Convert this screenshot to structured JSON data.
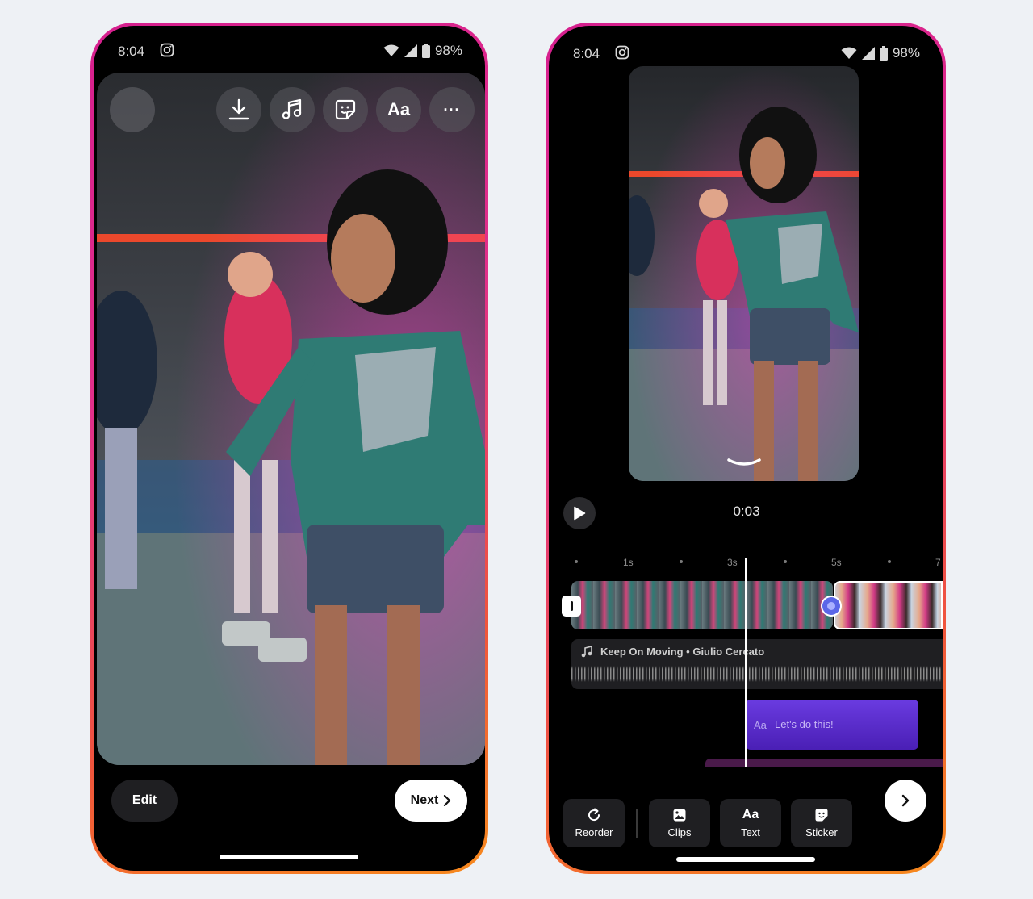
{
  "left_phone": {
    "status": {
      "time": "8:04",
      "battery": "98%"
    },
    "toolbar": {
      "icons": [
        "download-icon",
        "music-icon",
        "sticker-icon",
        "text-icon",
        "more-icon"
      ],
      "text_label": "Aa",
      "more_label": "···"
    },
    "bottom": {
      "edit_label": "Edit",
      "next_label": "Next"
    }
  },
  "right_phone": {
    "status": {
      "time": "8:04",
      "battery": "98%"
    },
    "player": {
      "time": "0:03"
    },
    "timeline": {
      "ticks": [
        "1s",
        "3s",
        "5s",
        "7"
      ]
    },
    "audio": {
      "track": "Keep On Moving • Giulio Cercato"
    },
    "text_clip": {
      "icon_label": "Aa",
      "text": "Let's do this!"
    },
    "tools": [
      {
        "label": "Reorder",
        "icon": "reorder-icon"
      },
      {
        "label": "Clips",
        "icon": "clips-icon"
      },
      {
        "label": "Text",
        "icon": "text-icon",
        "icon_label": "Aa"
      },
      {
        "label": "Sticker",
        "icon": "sticker-icon"
      }
    ]
  }
}
